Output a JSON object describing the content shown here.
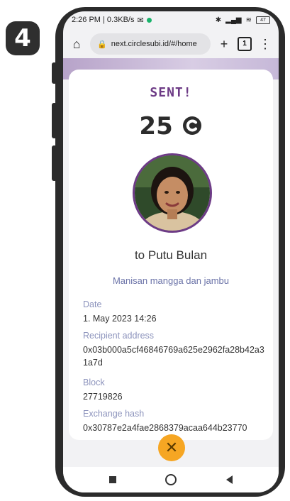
{
  "step_number": "4",
  "status_bar": {
    "time_info": "2:26 PM | 0.3KB/s",
    "battery": "47"
  },
  "browser": {
    "url": "next.circlesubi.id/#/home",
    "tab_count": "1"
  },
  "transaction": {
    "title": "SENT!",
    "amount": "25",
    "currency_icon": "circles-c-icon",
    "recipient": "to Putu Bulan",
    "memo": "Manisan mangga dan jambu",
    "fields": {
      "date_label": "Date",
      "date_value": "1. May 2023 14:26",
      "address_label": "Recipient address",
      "address_value": "0x03b000a5cf46846769a625e2962fa28b42a31a7d",
      "block_label": "Block",
      "block_value": "27719826",
      "hash_label": "Exchange hash",
      "hash_value": "0x30787e2a4fae2868379acaa644b23770"
    }
  },
  "colors": {
    "accent": "#6d3b86",
    "close_button": "#f6a623",
    "label": "#8c93bc"
  }
}
